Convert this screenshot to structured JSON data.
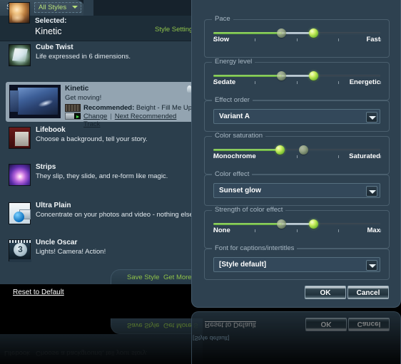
{
  "styles_panel": {
    "tab_label": "Styles",
    "filter": {
      "value": "All Styles",
      "icon": "chevron-down-icon"
    },
    "selected": {
      "caption": "Selected:",
      "name": "Kinetic",
      "settings_link": "Style Settings"
    },
    "items": [
      {
        "name": "Cube Twist",
        "desc": "Life expressed in 6 dimensions."
      },
      {
        "name": "Lifebook",
        "desc": "Choose a background, tell your story."
      },
      {
        "name": "Strips",
        "desc": "They slip, they slide, and re-form like magic."
      },
      {
        "name": "Ultra Plain",
        "desc": "Concentrate on your photos and video - nothing else."
      },
      {
        "name": "Uncle Oscar",
        "desc": "Lights! Camera! Action!"
      }
    ],
    "selected_item": {
      "name": "Kinetic",
      "desc": "Get moving!",
      "recommended_label": "Recommended:",
      "recommended_track": "Beight - Fill Me Up",
      "change_link": "Change",
      "separator": "|",
      "next_link": "Next Recommended Track"
    },
    "footer": {
      "save_style": "Save Style",
      "get_more": "Get More S"
    }
  },
  "dialog": {
    "groups": [
      {
        "title": "Pace",
        "type": "slider",
        "min_label": "Slow",
        "max_label": "Fast",
        "value_pct": 60,
        "ghost_pct": 41,
        "ticks_pct": [
          0,
          25,
          50,
          75,
          100
        ]
      },
      {
        "title": "Energy level",
        "type": "slider",
        "min_label": "Sedate",
        "max_label": "Energetic",
        "value_pct": 60,
        "ghost_pct": 41,
        "ticks_pct": [
          0,
          25,
          50,
          75,
          100
        ]
      },
      {
        "title": "Effect order",
        "type": "combo",
        "value": "Variant A",
        "icon": "chevron-down-icon"
      },
      {
        "title": "Color saturation",
        "type": "slider",
        "min_label": "Monochrome",
        "max_label": "Saturated",
        "value_pct": 40,
        "ghost_pct": 54,
        "ticks_pct": [
          0,
          25,
          50,
          75,
          100
        ]
      },
      {
        "title": "Color effect",
        "type": "combo",
        "value": "Sunset glow",
        "icon": "chevron-down-icon"
      },
      {
        "title": "Strength of color effect",
        "type": "slider",
        "min_label": "None",
        "max_label": "Max",
        "value_pct": 60,
        "ghost_pct": 41,
        "ticks_pct": [
          0,
          25,
          50,
          75,
          100
        ]
      },
      {
        "title": "Font for captions/intertitles",
        "type": "combo",
        "value": "[Style default]",
        "icon": "chevron-down-icon"
      }
    ],
    "reset_link": "Reset to Default",
    "ok_button": "OK",
    "cancel_button": "Cancel"
  },
  "reflection": {
    "reset_link": "Reset to Default",
    "ok_button": "OK",
    "cancel_button": "Cancel",
    "save_style": "Save Style",
    "get_more": "Get More S",
    "list_line_1": "Lifebook",
    "list_line_2": "Choose a background, tell your story.",
    "selected_text": "[Style default]"
  },
  "colors": {
    "panel_bg": "#2b3e4c",
    "dialog_bg": "#2e4150",
    "accent_green": "#8fc24a",
    "thumb_green": "#8fce3c",
    "selected_row": "#93a4b1"
  }
}
